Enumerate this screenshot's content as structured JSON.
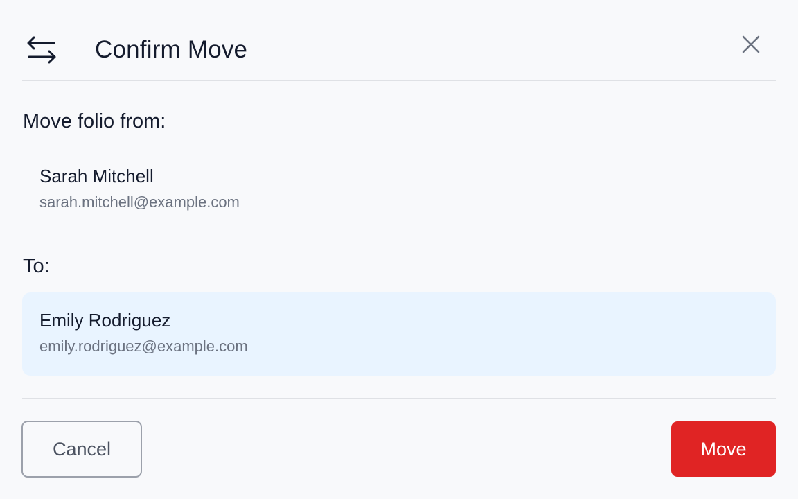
{
  "dialog": {
    "title": "Confirm Move",
    "header_icon": "swap-arrows-icon",
    "close_icon": "close-icon"
  },
  "from_section": {
    "label": "Move folio from:",
    "person": {
      "name": "Sarah Mitchell",
      "email": "sarah.mitchell@example.com"
    }
  },
  "to_section": {
    "label": "To:",
    "person": {
      "name": "Emily Rodriguez",
      "email": "emily.rodriguez@example.com"
    }
  },
  "actions": {
    "cancel_label": "Cancel",
    "move_label": "Move"
  },
  "colors": {
    "background": "#f8f9fb",
    "title_text": "#141b2d",
    "secondary_text": "#6b7280",
    "selected_card": "#e9f4ff",
    "danger": "#e02424",
    "divider": "#dfe1e5"
  }
}
